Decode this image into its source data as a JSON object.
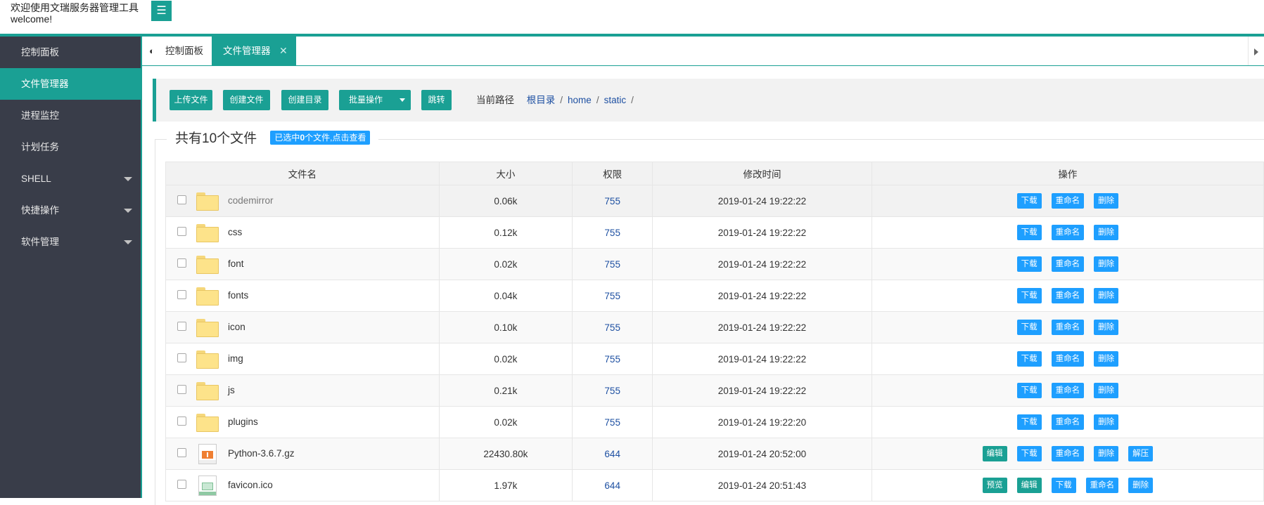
{
  "header": {
    "title_line1": "欢迎使用文瑞服务器管理工具",
    "title_line2": "welcome!",
    "menu_icon": "hamburger-icon",
    "accent_color": "#1aa094"
  },
  "sidebar": {
    "items": [
      {
        "label": "控制面板",
        "active": false,
        "has_submenu": false
      },
      {
        "label": "文件管理器",
        "active": true,
        "has_submenu": false
      },
      {
        "label": "进程监控",
        "active": false,
        "has_submenu": false
      },
      {
        "label": "计划任务",
        "active": false,
        "has_submenu": false
      },
      {
        "label": "SHELL",
        "active": false,
        "has_submenu": true
      },
      {
        "label": "快捷操作",
        "active": false,
        "has_submenu": true
      },
      {
        "label": "软件管理",
        "active": false,
        "has_submenu": true
      }
    ]
  },
  "tabs": {
    "dashboard": {
      "label": "控制面板",
      "icon": "dashboard-icon"
    },
    "file_manager": {
      "label": "文件管理器",
      "close": "✕"
    }
  },
  "toolbar": {
    "upload": "上传文件",
    "create_file": "创建文件",
    "create_dir": "创建目录",
    "batch": "批量操作",
    "jump": "跳转",
    "path_label": "当前路径",
    "path": [
      "根目录",
      "home",
      "static"
    ],
    "sep": "/"
  },
  "summary": {
    "title": "共有10个文件",
    "selected_pre": "已选中",
    "selected_count": "0",
    "selected_post": "个文件,点击查看"
  },
  "table": {
    "headers": [
      "文件名",
      "大小",
      "权限",
      "修改时间",
      "操作"
    ],
    "rows": [
      {
        "name": "codemirror",
        "type": "folder",
        "size": "0.06k",
        "perm": "755",
        "mtime": "2019-01-24 19:22:22",
        "ops": [
          "下载",
          "重命名",
          "删除"
        ]
      },
      {
        "name": "css",
        "type": "folder",
        "size": "0.12k",
        "perm": "755",
        "mtime": "2019-01-24 19:22:22",
        "ops": [
          "下载",
          "重命名",
          "删除"
        ]
      },
      {
        "name": "font",
        "type": "folder",
        "size": "0.02k",
        "perm": "755",
        "mtime": "2019-01-24 19:22:22",
        "ops": [
          "下载",
          "重命名",
          "删除"
        ]
      },
      {
        "name": "fonts",
        "type": "folder",
        "size": "0.04k",
        "perm": "755",
        "mtime": "2019-01-24 19:22:22",
        "ops": [
          "下载",
          "重命名",
          "删除"
        ]
      },
      {
        "name": "icon",
        "type": "folder",
        "size": "0.10k",
        "perm": "755",
        "mtime": "2019-01-24 19:22:22",
        "ops": [
          "下载",
          "重命名",
          "删除"
        ]
      },
      {
        "name": "img",
        "type": "folder",
        "size": "0.02k",
        "perm": "755",
        "mtime": "2019-01-24 19:22:22",
        "ops": [
          "下载",
          "重命名",
          "删除"
        ]
      },
      {
        "name": "js",
        "type": "folder",
        "size": "0.21k",
        "perm": "755",
        "mtime": "2019-01-24 19:22:22",
        "ops": [
          "下载",
          "重命名",
          "删除"
        ]
      },
      {
        "name": "plugins",
        "type": "folder",
        "size": "0.02k",
        "perm": "755",
        "mtime": "2019-01-24 19:22:20",
        "ops": [
          "下载",
          "重命名",
          "删除"
        ]
      },
      {
        "name": "Python-3.6.7.gz",
        "type": "archive",
        "size": "22430.80k",
        "perm": "644",
        "mtime": "2019-01-24 20:52:00",
        "ops": [
          "编辑",
          "下载",
          "重命名",
          "删除",
          "解压"
        ]
      },
      {
        "name": "favicon.ico",
        "type": "image",
        "size": "1.97k",
        "perm": "644",
        "mtime": "2019-01-24 20:51:43",
        "ops": [
          "预览",
          "编辑",
          "下载",
          "重命名",
          "删除"
        ]
      }
    ]
  }
}
